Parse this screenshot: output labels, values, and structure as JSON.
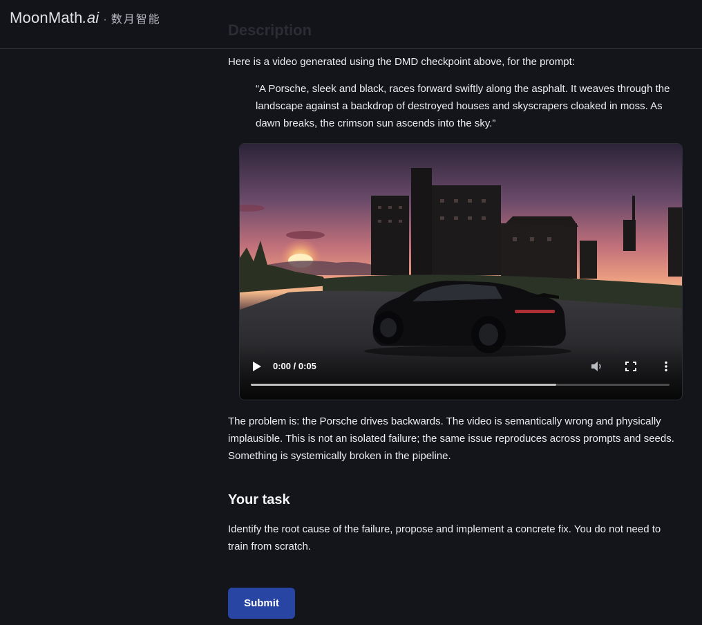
{
  "header": {
    "logo_text_main": "MoonMath",
    "logo_text_suffix": ".ai",
    "logo_separator": "·",
    "logo_text_cn": "数月智能",
    "faded_heading": "Description"
  },
  "content": {
    "intro": "Here is a video generated using the DMD checkpoint above, for the prompt:",
    "quote": "“A Porsche, sleek and black, races forward swiftly along the asphalt. It weaves through the landscape against a backdrop of destroyed houses and skyscrapers cloaked in moss. As dawn breaks, the crimson sun ascends into the sky.”",
    "video": {
      "time_display": "0:00 / 0:05",
      "buffered_fraction": 0.73,
      "icons": [
        "play-icon",
        "volume-icon",
        "fullscreen-icon",
        "more-options-icon"
      ]
    },
    "problem": "The problem is: the Porsche drives backwards. The video is semantically wrong and physically implausible. This is not an isolated failure; the same issue reproduces across prompts and seeds. Something is systemically broken in the pipeline.",
    "task_heading": "Your task",
    "task_text": "Identify the root cause of the failure, propose and implement a concrete fix. You do not need to train from scratch.",
    "submit_label": "Submit"
  },
  "colors": {
    "background": "#13151b",
    "accent": "#2845a3",
    "text": "#eceef2"
  }
}
